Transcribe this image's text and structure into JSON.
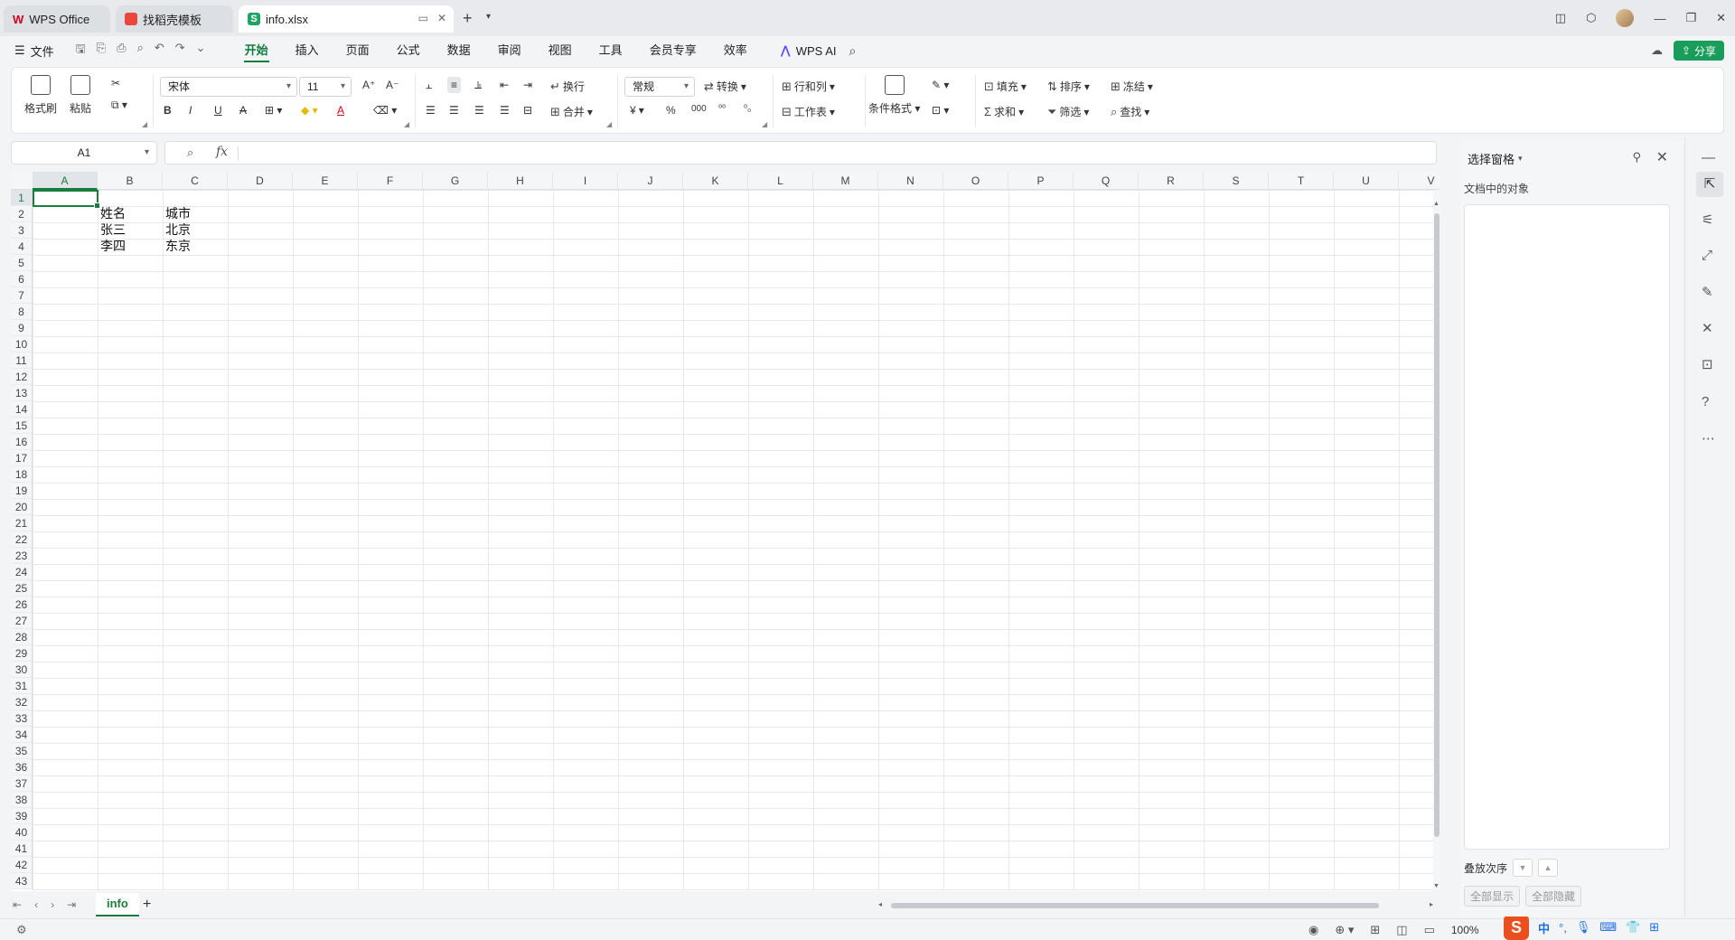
{
  "tabs": [
    {
      "label": "WPS Office"
    },
    {
      "label": "找稻壳模板"
    },
    {
      "label": "info.xlsx"
    }
  ],
  "menubar": {
    "file": "文件",
    "menus": [
      "开始",
      "插入",
      "页面",
      "公式",
      "数据",
      "审阅",
      "视图",
      "工具",
      "会员专享",
      "效率"
    ],
    "active_menu": "开始",
    "wps_ai": "WPS AI",
    "share": "分享"
  },
  "ribbon": {
    "format_painter": "格式刷",
    "paste": "粘贴",
    "font_name": "宋体",
    "font_size": "11",
    "wrap": "换行",
    "merge": "合并",
    "number_format": "常规",
    "convert": "转换",
    "row_col": "行和列",
    "worksheet": "工作表",
    "cond_format": "条件格式",
    "fill": "填充",
    "sort": "排序",
    "freeze": "冻结",
    "sum": "求和",
    "filter": "筛选",
    "find": "查找",
    "bold": "B",
    "italic": "I",
    "underline": "U",
    "strike": "A",
    "font_color": "A",
    "currency": "¥",
    "percent": "%",
    "thousands": "000"
  },
  "formula_bar": {
    "name_box": "A1",
    "fx": "fx",
    "value": ""
  },
  "grid": {
    "columns": [
      "A",
      "B",
      "C",
      "D",
      "E",
      "F",
      "G",
      "H",
      "I",
      "J",
      "K",
      "L",
      "M",
      "N",
      "O",
      "P",
      "Q",
      "R",
      "S",
      "T",
      "U",
      "V"
    ],
    "active_column": "A",
    "active_row": 1,
    "row_count": 43,
    "cells": [
      {
        "ref": "B2",
        "value": "姓名"
      },
      {
        "ref": "C2",
        "value": "城市"
      },
      {
        "ref": "B3",
        "value": "张三"
      },
      {
        "ref": "C3",
        "value": "北京"
      },
      {
        "ref": "B4",
        "value": "李四"
      },
      {
        "ref": "C4",
        "value": "东京"
      }
    ]
  },
  "sheet_tabs": {
    "tabs": [
      "info"
    ],
    "active": "info",
    "add": "+"
  },
  "status": {
    "zoom": "100%"
  },
  "selection_pane": {
    "title": "选择窗格",
    "subtitle": "文档中的对象",
    "order_label": "叠放次序",
    "show_all": "全部显示",
    "hide_all": "全部隐藏"
  },
  "ime": {
    "logo": "S",
    "lang": "中"
  }
}
